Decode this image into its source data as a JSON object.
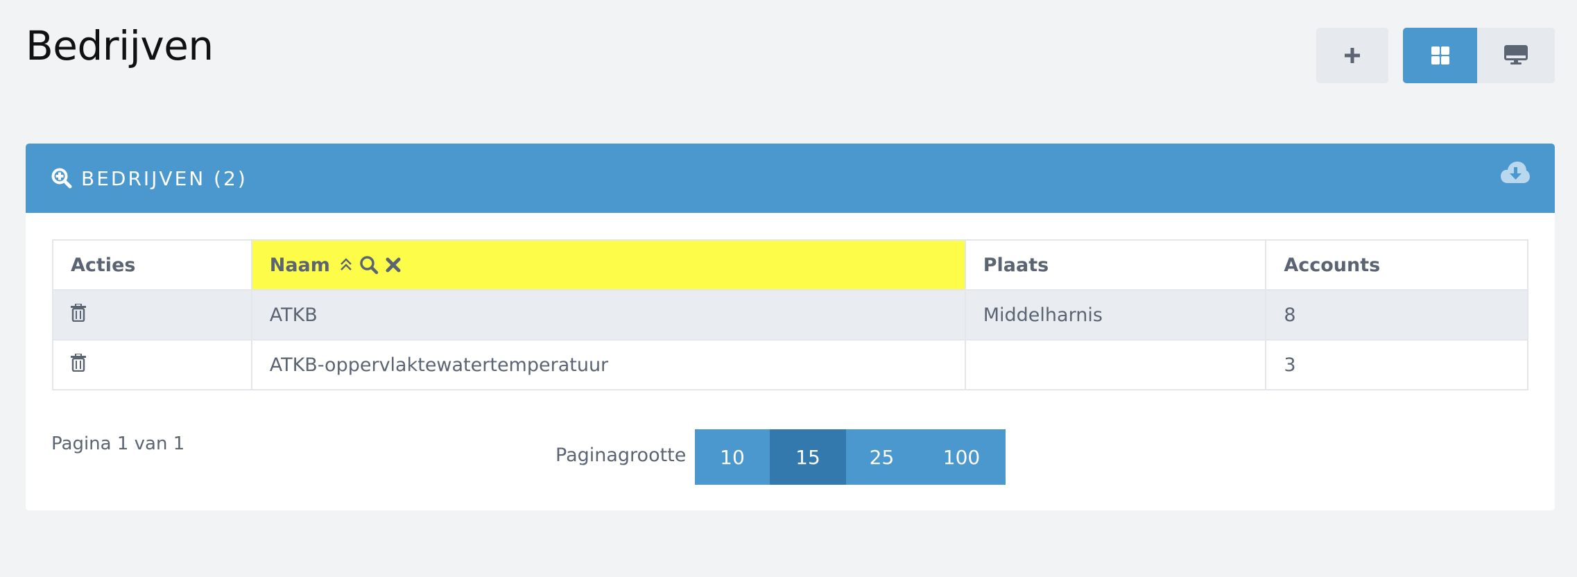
{
  "page": {
    "title": "Bedrijven"
  },
  "toolbar": {
    "add_icon": "plus-icon",
    "grid_icon": "grid-icon",
    "screen_icon": "monitor-icon",
    "active_view": "grid",
    "accent": "#4a98ce"
  },
  "panel": {
    "title": "BEDRIJVEN (2)",
    "title_icon": "zoom-in-icon",
    "download_icon": "cloud-download-icon"
  },
  "table": {
    "headers": {
      "actions": "Acties",
      "name": "Naam",
      "city": "Plaats",
      "accounts": "Accounts"
    },
    "sorted_column_highlight": "#fdfd49",
    "rows": [
      {
        "name": "ATKB",
        "city": "Middelharnis",
        "accounts": "8"
      },
      {
        "name": "ATKB-oppervlaktewatertemperatuur",
        "city": "",
        "accounts": "3"
      }
    ]
  },
  "pagination": {
    "info": "Pagina 1 van 1",
    "size_label": "Paginagrootte",
    "sizes": [
      "10",
      "15",
      "25",
      "100"
    ],
    "selected_size": "15"
  }
}
